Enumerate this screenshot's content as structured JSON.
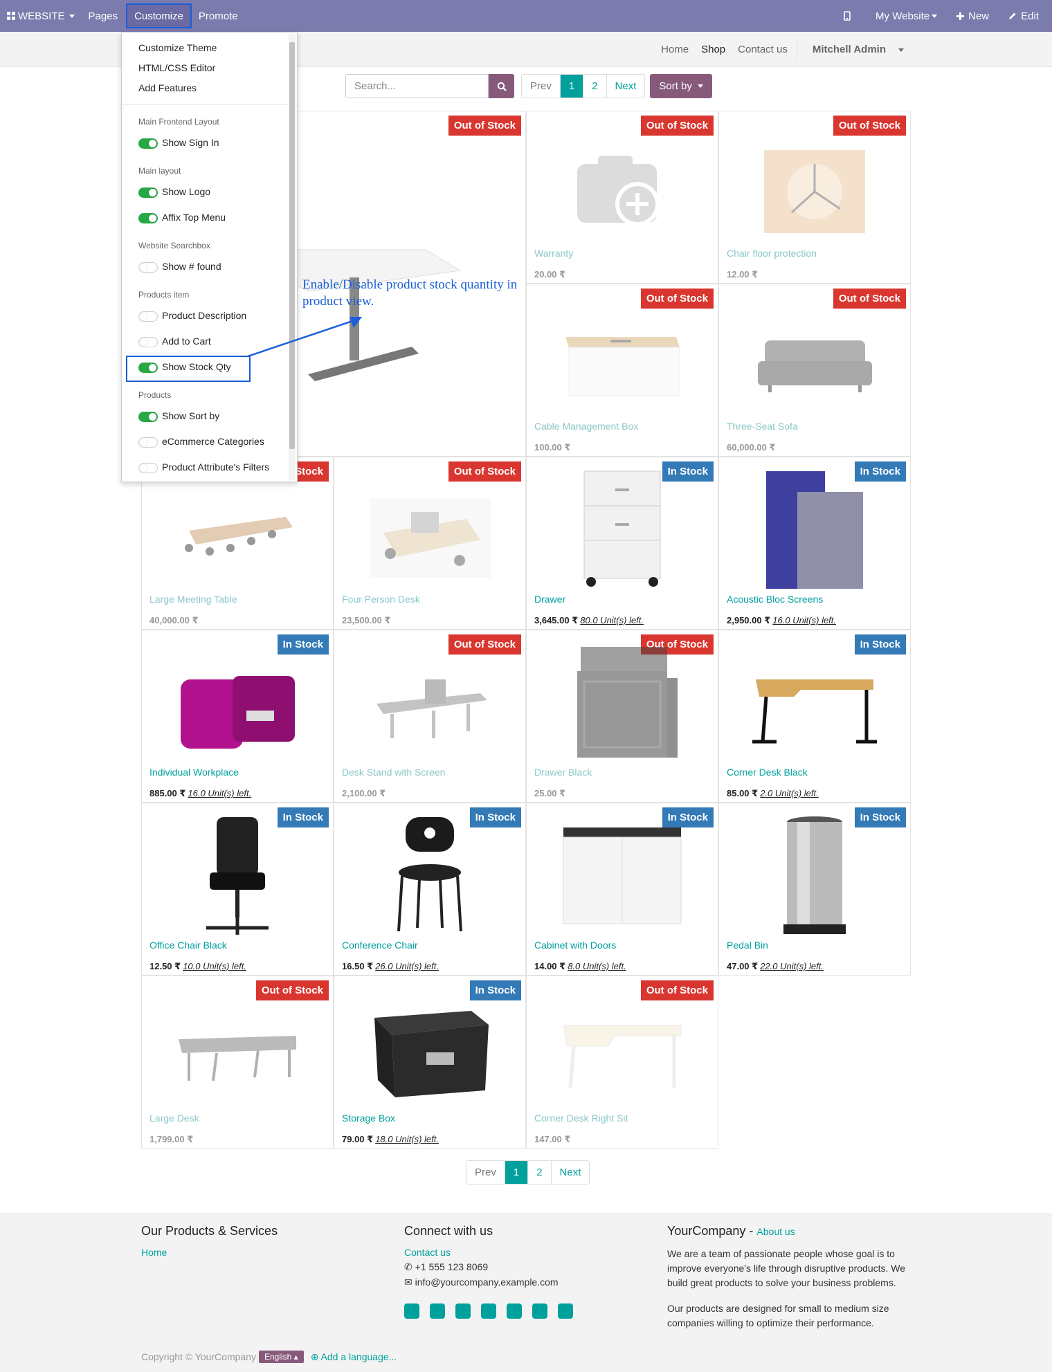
{
  "adminbar": {
    "website": "WEBSITE",
    "pages": "Pages",
    "customize": "Customize",
    "promote": "Promote",
    "my_website": "My Website",
    "new": "New",
    "edit": "Edit"
  },
  "subnav": {
    "home": "Home",
    "shop": "Shop",
    "contact": "Contact us",
    "user": "Mitchell Admin"
  },
  "search": {
    "placeholder": "Search..."
  },
  "pager": {
    "prev": "Prev",
    "p1": "1",
    "p2": "2",
    "next": "Next"
  },
  "sort_by": "Sort by",
  "dropdown": {
    "customize_theme": "Customize Theme",
    "html_css_editor": "HTML/CSS Editor",
    "add_features": "Add Features",
    "sections": [
      {
        "heading": "Main Frontend Layout",
        "toggles": [
          {
            "label": "Show Sign In",
            "on": true
          }
        ]
      },
      {
        "heading": "Main layout",
        "toggles": [
          {
            "label": "Show Logo",
            "on": true
          },
          {
            "label": "Affix Top Menu",
            "on": true
          }
        ]
      },
      {
        "heading": "Website Searchbox",
        "toggles": [
          {
            "label": "Show # found",
            "on": false
          }
        ]
      },
      {
        "heading": "Products item",
        "toggles": [
          {
            "label": "Product Description",
            "on": false
          },
          {
            "label": "Add to Cart",
            "on": false
          },
          {
            "label": "Show Stock Qty",
            "on": true
          }
        ]
      },
      {
        "heading": "Products",
        "toggles": [
          {
            "label": "Show Sort by",
            "on": true
          },
          {
            "label": "eCommerce Categories",
            "on": false
          },
          {
            "label": "Product Attribute's Filters",
            "on": false
          }
        ]
      }
    ]
  },
  "annotation": "Enable/Disable product stock quantity in product view.",
  "products": {
    "p0": {
      "badge": "Out of Stock"
    },
    "p1": {
      "name": "Warranty",
      "price": "20.00 ₹",
      "badge": "Out of Stock"
    },
    "p2": {
      "name": "Chair floor protection",
      "price": "12.00 ₹",
      "badge": "Out of Stock"
    },
    "p3": {
      "name": "Cable Management Box",
      "price": "100.00 ₹",
      "badge": "Out of Stock"
    },
    "p4": {
      "name": "Three-Seat Sofa",
      "price": "60,000.00 ₹",
      "badge": "Out of Stock"
    },
    "p5": {
      "name": "Large Meeting Table",
      "price": "40,000.00 ₹",
      "badge": "Stock"
    },
    "p6": {
      "name": "Four Person Desk",
      "price": "23,500.00 ₹",
      "badge": "Out of Stock"
    },
    "p7": {
      "name": "Drawer",
      "price": "3,645.00 ₹",
      "stock": "80.0 Unit(s) left.",
      "badge": "In Stock"
    },
    "p8": {
      "name": "Acoustic Bloc Screens",
      "price": "2,950.00 ₹",
      "stock": "16.0 Unit(s) left.",
      "badge": "In Stock"
    },
    "p9": {
      "name": "Individual Workplace",
      "price": "885.00 ₹",
      "stock": "16.0 Unit(s) left.",
      "badge": "In Stock"
    },
    "p10": {
      "name": "Desk Stand with Screen",
      "price": "2,100.00 ₹",
      "badge": "Out of Stock"
    },
    "p11": {
      "name": "Drawer Black",
      "price": "25.00 ₹",
      "badge": "Out of Stock"
    },
    "p12": {
      "name": "Corner Desk Black",
      "price": "85.00 ₹",
      "stock": "2.0 Unit(s) left.",
      "badge": "In Stock"
    },
    "p13": {
      "name": "Office Chair Black",
      "price": "12.50 ₹",
      "stock": "10.0 Unit(s) left.",
      "badge": "In Stock"
    },
    "p14": {
      "name": "Conference Chair",
      "price": "16.50 ₹",
      "stock": "26.0 Unit(s) left.",
      "badge": "In Stock"
    },
    "p15": {
      "name": "Cabinet with Doors",
      "price": "14.00 ₹",
      "stock": "8.0 Unit(s) left.",
      "badge": "In Stock"
    },
    "p16": {
      "name": "Pedal Bin",
      "price": "47.00 ₹",
      "stock": "22.0 Unit(s) left.",
      "badge": "In Stock"
    },
    "p17": {
      "name": "Large Desk",
      "price": "1,799.00 ₹",
      "badge": "Out of Stock"
    },
    "p18": {
      "name": "Storage Box",
      "price": "79.00 ₹",
      "stock": "18.0 Unit(s) left.",
      "badge": "In Stock"
    },
    "p19": {
      "name": "Corner Desk Right Sit",
      "price": "147.00 ₹",
      "badge": "Out of Stock"
    }
  },
  "footer": {
    "col1_title": "Our Products & Services",
    "col1_home": "Home",
    "col2_title": "Connect with us",
    "col2_contact": "Contact us",
    "col2_phone": "+1 555 123 8069",
    "col2_email": "info@yourcompany.example.com",
    "col3_title": "YourCompany",
    "col3_dash": " - ",
    "col3_about": "About us",
    "col3_p1": "We are a team of passionate people whose goal is to improve everyone's life through disruptive products. We build great products to solve your business problems.",
    "col3_p2": "Our products are designed for small to medium size companies willing to optimize their performance.",
    "copyright": "Copyright © YourCompany",
    "language": "English",
    "add_language": "Add a language..."
  }
}
